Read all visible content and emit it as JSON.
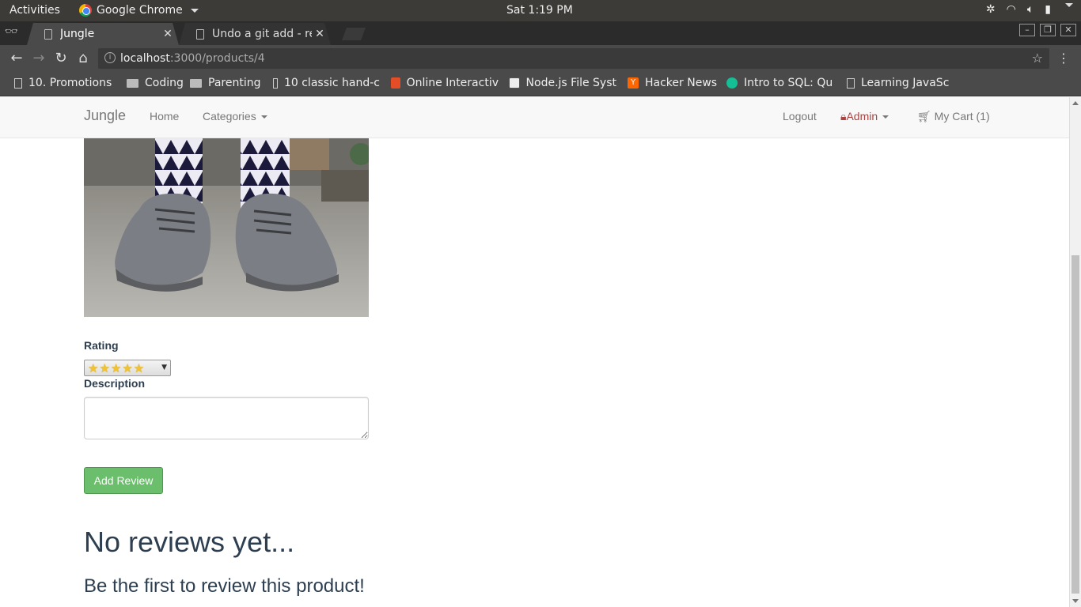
{
  "os": {
    "activities": "Activities",
    "app_name": "Google Chrome",
    "clock": "Sat  1:19 PM"
  },
  "browser": {
    "tabs": [
      {
        "title": "Jungle",
        "active": true
      },
      {
        "title": "Undo a git add - rem",
        "active": false
      }
    ],
    "url_host": "localhost",
    "url_path": ":3000/products/4",
    "bookmarks": [
      {
        "label": "10. Promotions",
        "icon": "page-icon"
      },
      {
        "label": "Coding",
        "icon": "folder-icon"
      },
      {
        "label": "Parenting",
        "icon": "folder-icon"
      },
      {
        "label": "10 classic hand-c",
        "icon": "page-icon"
      },
      {
        "label": "Online Interactiv",
        "icon": "html5-icon"
      },
      {
        "label": "Node.js File Syst",
        "icon": "w3-icon"
      },
      {
        "label": "Hacker News",
        "icon": "y-icon"
      },
      {
        "label": "Intro to SQL: Qu",
        "icon": "khan-icon"
      },
      {
        "label": "Learning JavaSc",
        "icon": "page-icon"
      }
    ]
  },
  "navbar": {
    "brand": "Jungle",
    "home": "Home",
    "categories": "Categories",
    "logout": "Logout",
    "admin": "Admin",
    "cart": "My Cart (1)"
  },
  "review_form": {
    "rating_label": "Rating",
    "rating_value": "★★★★★",
    "description_label": "Description",
    "description_value": "",
    "submit_label": "Add Review"
  },
  "reviews": {
    "heading": "No reviews yet...",
    "subheading": "Be the first to review this product!"
  },
  "colors": {
    "submit_green": "#5cb85c",
    "admin_red": "#a94442",
    "heading_color": "#2c3e50"
  }
}
